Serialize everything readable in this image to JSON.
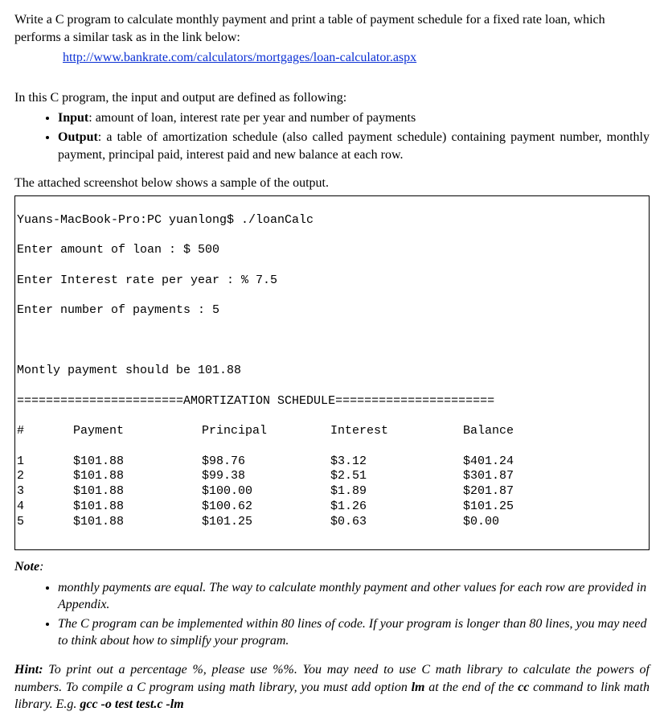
{
  "intro": {
    "line1": "Write a C program to calculate monthly payment and print a table of payment schedule for a fixed rate loan, which performs a similar task as in the link below:",
    "link_text": "http://www.bankrate.com/calculators/mortgages/loan-calculator.aspx"
  },
  "io": {
    "lead": "In this C program, the input and output are defined as following:",
    "input_label": "Input",
    "input_text": ": amount of loan, interest rate per year and number of payments",
    "output_label": "Output",
    "output_text": ": a table of amortization schedule (also called payment schedule) containing payment number, monthly payment, principal paid, interest paid and new balance at each row."
  },
  "sample_lead": "The attached screenshot below shows a sample of the output.",
  "term": {
    "cmd": "Yuans-MacBook-Pro:PC yuanlong$ ./loanCalc",
    "p1": "Enter amount of loan : $ 500",
    "p2": "Enter Interest rate per year : % 7.5",
    "p3": "Enter number of payments : 5",
    "blank": " ",
    "mp": "Montly payment should be 101.88",
    "divider": "=======================AMORTIZATION SCHEDULE======================",
    "headers": [
      "#",
      "Payment",
      "Principal",
      "Interest",
      "Balance"
    ],
    "rows": [
      [
        "1",
        "$101.88",
        "$98.76",
        "$3.12",
        "$401.24"
      ],
      [
        "2",
        "$101.88",
        "$99.38",
        "$2.51",
        "$301.87"
      ],
      [
        "3",
        "$101.88",
        "$100.00",
        "$1.89",
        "$201.87"
      ],
      [
        "4",
        "$101.88",
        "$100.62",
        "$1.26",
        "$101.25"
      ],
      [
        "5",
        "$101.88",
        "$101.25",
        "$0.63",
        "$0.00"
      ]
    ]
  },
  "note": {
    "label": "Note",
    "b1": "monthly payments are equal. The way to calculate monthly payment and other values for each row are provided in Appendix.",
    "b2": "The C program can be implemented within 80 lines of code. If your program is longer than 80 lines, you may need to think about how to simplify your program."
  },
  "hint": {
    "label": "Hint:",
    "body_a": " To print out a percentage %, please use %%. You may need to use C math library to calculate the powers of numbers. To compile a C program using math library, you must add option ",
    "opt": "lm",
    "body_b": " at the end of the ",
    "cc": "cc",
    "body_c": " command to link math library. E.g. ",
    "example": "gcc -o test test.c -lm"
  }
}
